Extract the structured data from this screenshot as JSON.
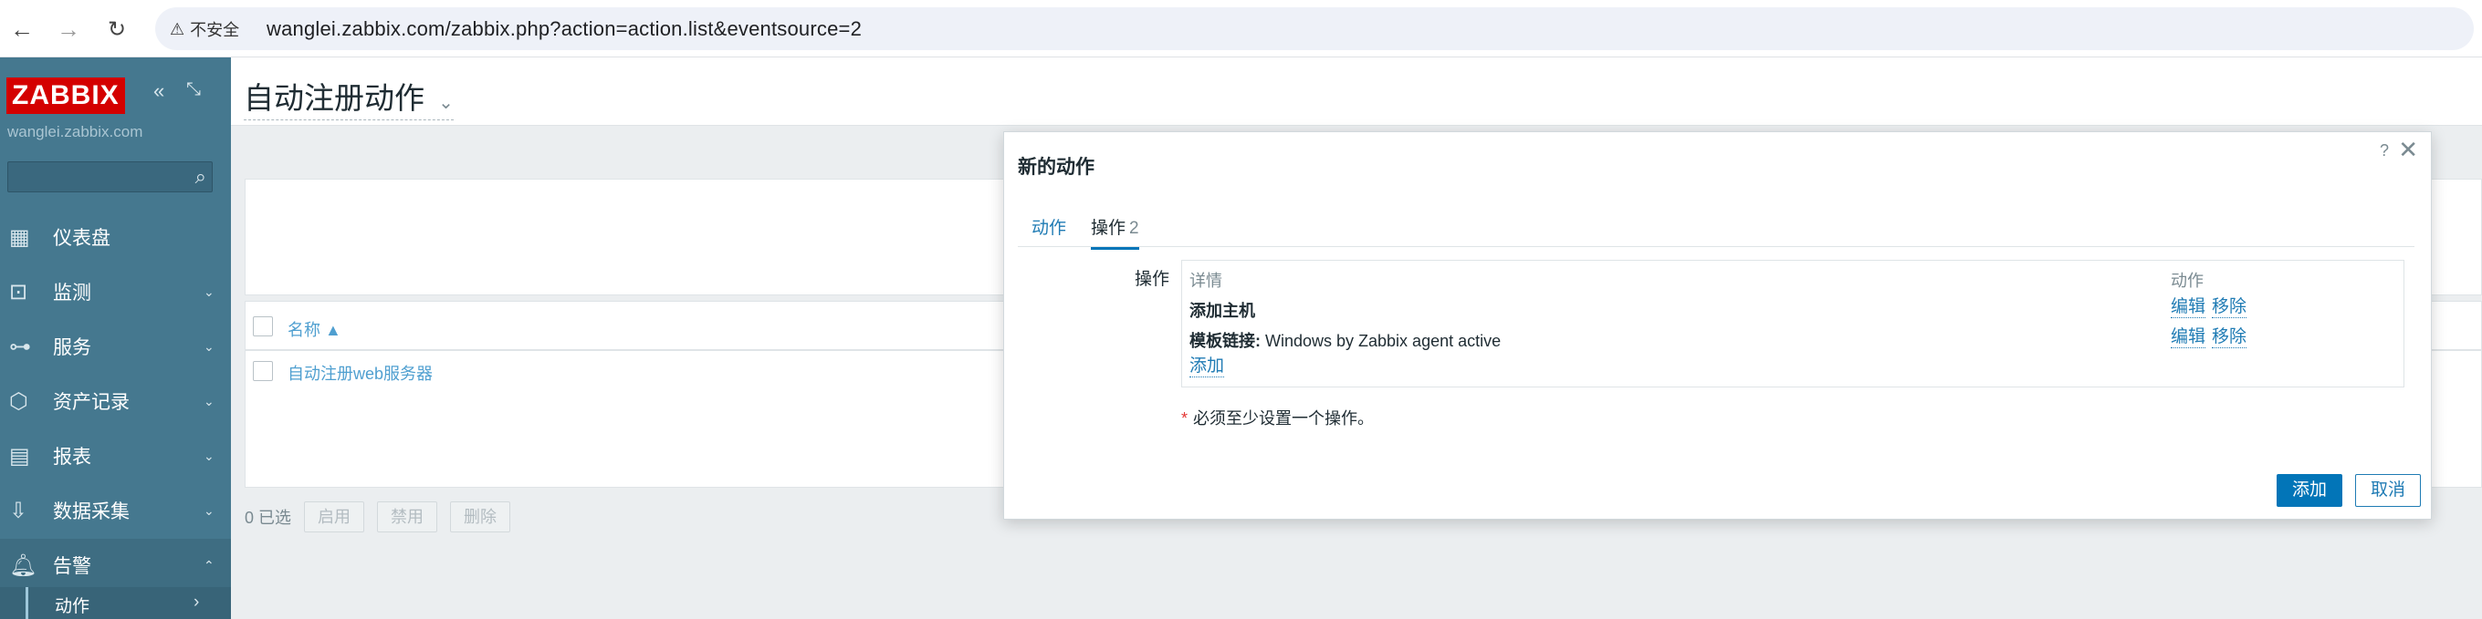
{
  "browser": {
    "back_icon": "arrow-left-icon",
    "forward_icon": "arrow-right-icon",
    "reload_icon": "reload-icon",
    "insecure_label": "不安全",
    "url": "wanglei.zabbix.com/zabbix.php?action=action.list&eventsource=2"
  },
  "sidebar": {
    "logo": "ZABBIX",
    "server": "wanglei.zabbix.com",
    "search_placeholder": "",
    "items": [
      {
        "label": "仪表盘",
        "icon": "dashboard-icon",
        "chevron": ""
      },
      {
        "label": "监测",
        "icon": "monitoring-icon",
        "chevron": "⌄"
      },
      {
        "label": "服务",
        "icon": "services-icon",
        "chevron": "⌄"
      },
      {
        "label": "资产记录",
        "icon": "inventory-icon",
        "chevron": "⌄"
      },
      {
        "label": "报表",
        "icon": "reports-icon",
        "chevron": "⌄"
      },
      {
        "label": "数据采集",
        "icon": "data-collection-icon",
        "chevron": "⌄"
      },
      {
        "label": "告警",
        "icon": "alerts-icon",
        "chevron": "⌃"
      }
    ],
    "sub_item": {
      "label": "动作",
      "arrow": "›"
    }
  },
  "page": {
    "title": "自动注册动作",
    "list": {
      "col_name": "名称 ▲",
      "rows": [
        {
          "name": "自动注册web服务器"
        }
      ]
    },
    "footer": {
      "selected": "0 已选",
      "enable": "启用",
      "disable": "禁用",
      "delete": "删除"
    }
  },
  "modal": {
    "title": "新的动作",
    "help": "?",
    "close": "✕",
    "tabs": [
      {
        "label": "动作",
        "count": ""
      },
      {
        "label": "操作",
        "count": "2"
      }
    ],
    "operations_label": "操作",
    "table": {
      "col_details": "详情",
      "col_action": "动作",
      "rows": [
        {
          "label": "添加主机",
          "value": "",
          "edit": "编辑",
          "remove": "移除"
        },
        {
          "label": "模板链接:",
          "value": " Windows by Zabbix agent active",
          "edit": "编辑",
          "remove": "移除"
        }
      ],
      "add": "添加"
    },
    "required_note": "必须至少设置一个操作。",
    "add_button": "添加",
    "cancel_button": "取消"
  }
}
